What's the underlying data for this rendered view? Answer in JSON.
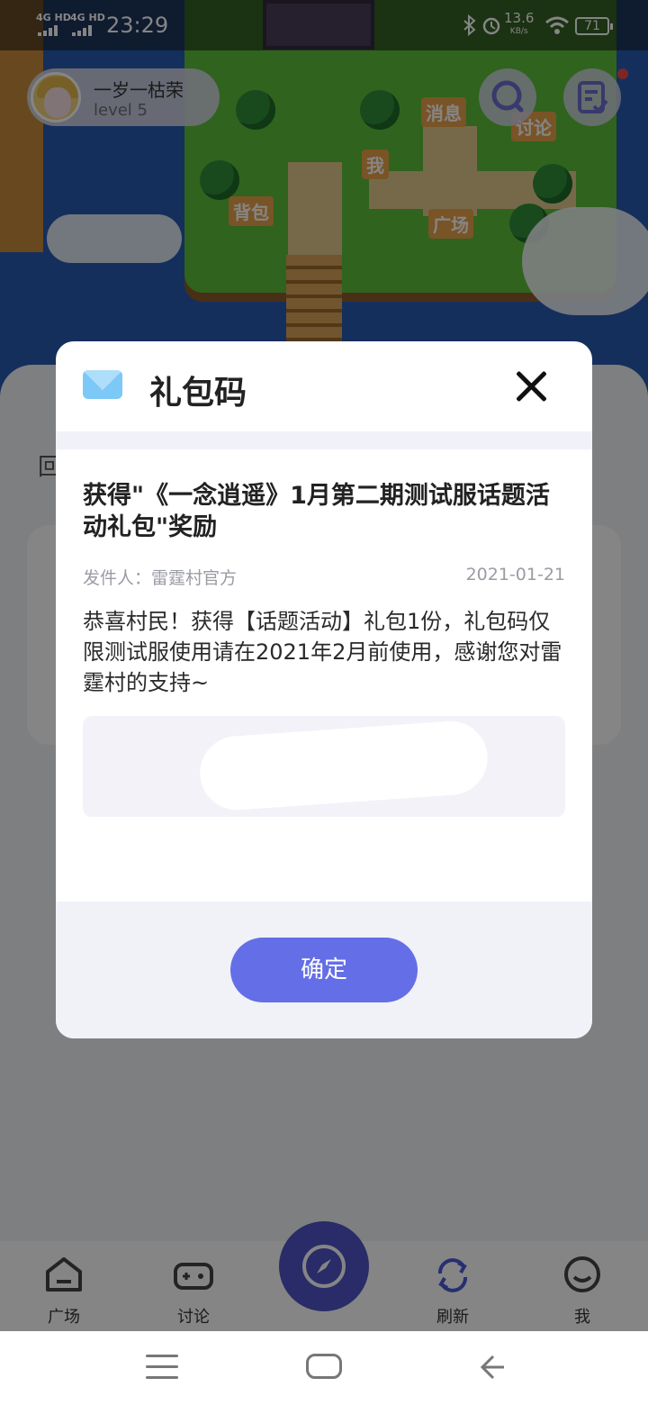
{
  "status_bar": {
    "network_1": "4G HD",
    "network_2": "4G HD",
    "time": "23:29",
    "speed_value": "13.6",
    "speed_unit": "KB/s",
    "battery": "71"
  },
  "profile": {
    "name": "一岁一枯荣",
    "level": "level 5"
  },
  "map": {
    "labels": {
      "messages": "消息",
      "discuss": "讨论",
      "me": "我",
      "backpack": "背包",
      "plaza": "广场"
    }
  },
  "page": {
    "hint_char": "回"
  },
  "bottom_nav": {
    "items": [
      {
        "label": "广场",
        "icon": "home-icon"
      },
      {
        "label": "讨论",
        "icon": "gamepad-icon"
      },
      {
        "label": "刷新",
        "icon": "refresh-icon"
      },
      {
        "label": "我",
        "icon": "smile-icon"
      }
    ],
    "center_icon": "compass-icon"
  },
  "dialog": {
    "title": "礼包码",
    "message_title": "获得\"《一念逍遥》1月第二期测试服话题活动礼包\"奖励",
    "sender": "发件人：雷霆村官方",
    "date": "2021-01-21",
    "body": "恭喜村民！获得【话题活动】礼包1份，礼包码仅限测试服使用请在2021年2月前使用，感谢您对雷霆村的支持~",
    "confirm_label": "确定"
  },
  "colors": {
    "accent": "#646ee6",
    "nav_center": "#4f55c8",
    "mail_icon": "#7cc8f7"
  }
}
